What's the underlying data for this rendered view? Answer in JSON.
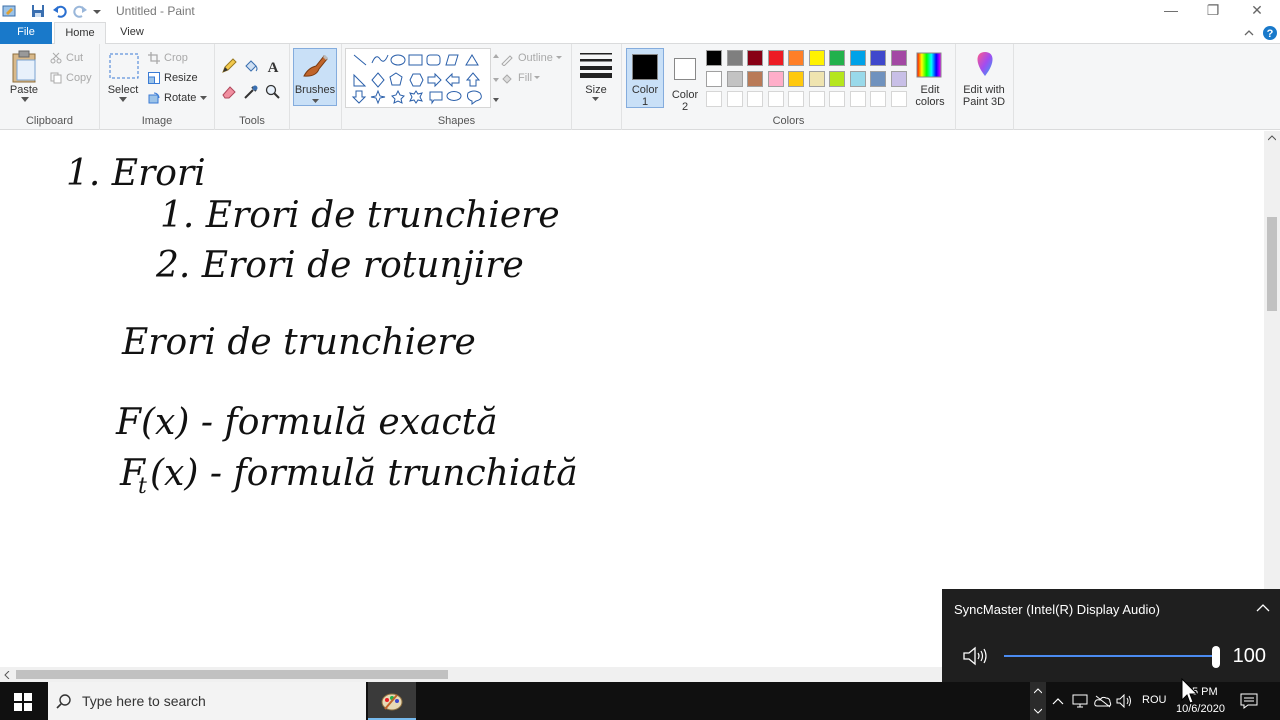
{
  "window": {
    "title": "Untitled - Paint"
  },
  "tabs": [
    {
      "label": "File"
    },
    {
      "label": "Home"
    },
    {
      "label": "View"
    }
  ],
  "ribbon": {
    "clipboard": {
      "paste_label": "Paste",
      "cut_label": "Cut",
      "copy_label": "Copy",
      "group_label": "Clipboard"
    },
    "image": {
      "select_label": "Select",
      "crop_label": "Crop",
      "resize_label": "Resize",
      "rotate_label": "Rotate",
      "group_label": "Image"
    },
    "tools": {
      "group_label": "Tools"
    },
    "brushes": {
      "label": "Brushes"
    },
    "shapes": {
      "outline_label": "Outline",
      "fill_label": "Fill",
      "group_label": "Shapes"
    },
    "size": {
      "label": "Size"
    },
    "colors": {
      "color1_label": "Color",
      "color1_num": "1",
      "color2_label": "Color",
      "color2_num": "2",
      "edit_colors_label_1": "Edit",
      "edit_colors_label_2": "colors",
      "group_label": "Colors",
      "color1": "#000000",
      "color2": "#ffffff",
      "palette_row1": [
        "#000000",
        "#7f7f7f",
        "#880015",
        "#ed1c24",
        "#ff7f27",
        "#fff200",
        "#22b14c",
        "#00a2e8",
        "#3f48cc",
        "#a349a4"
      ],
      "palette_row2": [
        "#ffffff",
        "#c3c3c3",
        "#b97a57",
        "#ffaec9",
        "#ffc90e",
        "#efe4b0",
        "#b5e61d",
        "#99d9ea",
        "#7092be",
        "#c8bfe7"
      ]
    },
    "paint3d": {
      "label_1": "Edit with",
      "label_2": "Paint 3D"
    }
  },
  "canvas": {
    "lines": [
      "1. Erori",
      "1. Erori de trunchiere",
      "2. Erori de rotunjire",
      "Erori de trunchiere",
      "F(x) - formulă exactă",
      "F",
      "t",
      "(x) - formulă trunchiată"
    ]
  },
  "taskbar": {
    "search_placeholder": "Type here to search",
    "language": "ROU",
    "time": "5 PM",
    "date": "10/6/2020"
  },
  "volume": {
    "device": "SyncMaster (Intel(R) Display Audio)",
    "level": "100",
    "level_fraction": 1.0
  }
}
